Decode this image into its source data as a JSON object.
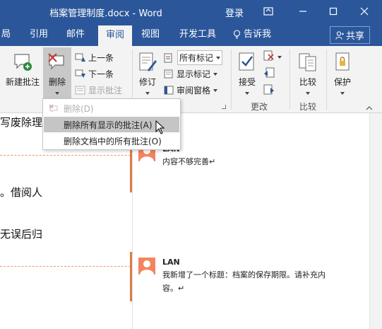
{
  "titlebar": {
    "title": "档案管理制度.docx - Word",
    "login": "登录",
    "bg_color": "#2b579a"
  },
  "tabs": [
    {
      "label": "局",
      "active": false
    },
    {
      "label": "引用",
      "active": false
    },
    {
      "label": "邮件",
      "active": false
    },
    {
      "label": "审阅",
      "active": true
    },
    {
      "label": "视图",
      "active": false
    },
    {
      "label": "开发工具",
      "active": false
    },
    {
      "label": "告诉我",
      "active": false
    }
  ],
  "share_label": "共享",
  "ribbon": {
    "new_comment": "新建批注",
    "delete": "删除",
    "prev": "上一条",
    "next": "下一条",
    "show_comments": "显示批注",
    "track_changes": "修订",
    "all_markup": "所有标记",
    "show_markup": "显示标记",
    "review_pane": "审阅窗格",
    "accept": "接受",
    "changes_group": "更改",
    "compare": "比较",
    "compare_group": "比较",
    "protect": "保护"
  },
  "menu": {
    "items": [
      {
        "label": "删除(D)",
        "state": "disabled"
      },
      {
        "label": "删除所有显示的批注(A)",
        "state": "hover"
      },
      {
        "label": "删除文档中的所有批注(O)",
        "state": "normal"
      }
    ]
  },
  "document": {
    "lines": [
      "写废除理",
      "。借阅人",
      "无误后归"
    ]
  },
  "comments": [
    {
      "author": "LAN",
      "lines": [
        "内容不够完善↵"
      ]
    },
    {
      "author": "LAN",
      "lines": [
        "我新增了一个标题：档案的保存期限。请补充内",
        "容。↵"
      ]
    }
  ],
  "colors": {
    "accent": "#2b579a",
    "comment_marker": "#e07a44",
    "avatar": "#f4845f"
  }
}
